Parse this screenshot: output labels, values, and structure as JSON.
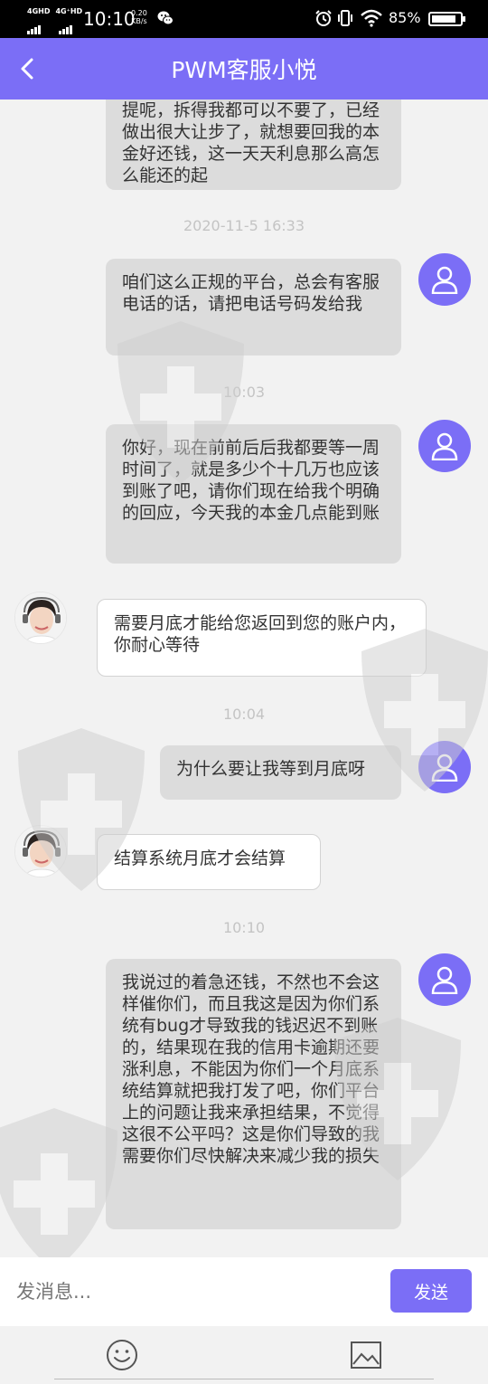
{
  "status_bar": {
    "network1": "4GHD",
    "network2": "4G⁺HD",
    "time": "10:10",
    "speed_value": "0.20",
    "speed_unit": "KB/s",
    "battery": "85%",
    "battery_level": 0.85
  },
  "header": {
    "title": "PWM客服小悦",
    "accent_color": "#7b6ef6"
  },
  "messages": [
    {
      "from": "me",
      "text": "提呢，拆得我都可以不要了，已经做出很大让步了，就想要回我的本金好还钱，这一天天利息那么高怎么能还的起"
    },
    {
      "timestamp": "2020-11-5 16:33"
    },
    {
      "from": "me",
      "text": "咱们这么正规的平台，总会有客服电话的话，请把电话号码发给我"
    },
    {
      "timestamp": "10:03"
    },
    {
      "from": "me",
      "text": "你好，现在前前后后我都要等一周时间了，就是多少个十几万也应该到账了吧，请你们现在给我个明确的回应，今天我的本金几点能到账"
    },
    {
      "from": "agent",
      "text": "需要月底才能给您返回到您的账户内，你耐心等待"
    },
    {
      "timestamp": "10:04"
    },
    {
      "from": "me",
      "text": "为什么要让我等到月底呀"
    },
    {
      "from": "agent",
      "text": "结算系统月底才会结算"
    },
    {
      "timestamp": "10:10"
    },
    {
      "from": "me",
      "text": "我说过的着急还钱，不然也不会这样催你们，而且我这是因为你们系统有bug才导致我的钱迟迟不到账的，结果现在我的信用卡逾期还要涨利息，不能因为你们一个月底系统结算就把我打发了吧，你们平台上的问题让我来承担结果，不觉得这很不公平吗？这是你们导致的我需要你们尽快解决来减少我的损失"
    }
  ],
  "input": {
    "placeholder": "发消息...",
    "send_label": "发送"
  },
  "toolbar": {
    "emoji_icon": "smiley-icon",
    "image_icon": "image-icon"
  }
}
